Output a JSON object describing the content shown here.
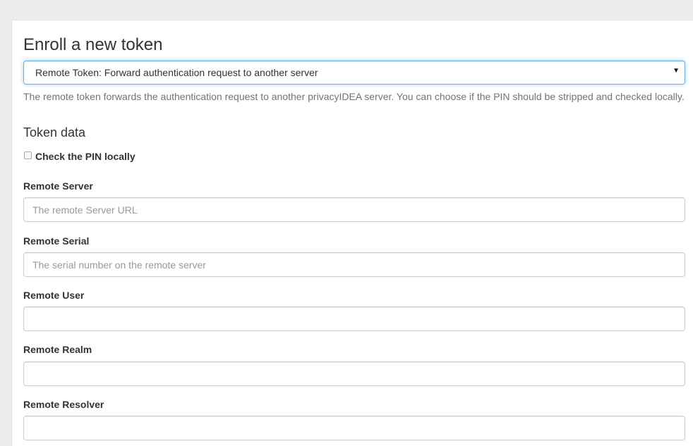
{
  "enroll": {
    "title": "Enroll a new token",
    "token_type_selected": "Remote Token: Forward authentication request to another server",
    "description": "The remote token forwards the authentication request to another privacyIDEA server. You can choose if the PIN should be stripped and checked locally.",
    "token_data_heading": "Token data",
    "check_pin_label": "Check the PIN locally",
    "check_pin_checked": false,
    "fields": {
      "remote_server": {
        "label": "Remote Server",
        "placeholder": "The remote Server URL",
        "value": ""
      },
      "remote_serial": {
        "label": "Remote Serial",
        "placeholder": "The serial number on the remote server",
        "value": ""
      },
      "remote_user": {
        "label": "Remote User",
        "placeholder": "",
        "value": ""
      },
      "remote_realm": {
        "label": "Remote Realm",
        "placeholder": "",
        "value": ""
      },
      "remote_resolver": {
        "label": "Remote Resolver",
        "placeholder": "",
        "value": ""
      }
    }
  },
  "icons": {
    "select_caret": "caret-down-icon"
  },
  "colors": {
    "focus_border": "#66afe9",
    "input_border": "#cccccc",
    "help_text": "#737373",
    "page_bg": "#ececec"
  }
}
